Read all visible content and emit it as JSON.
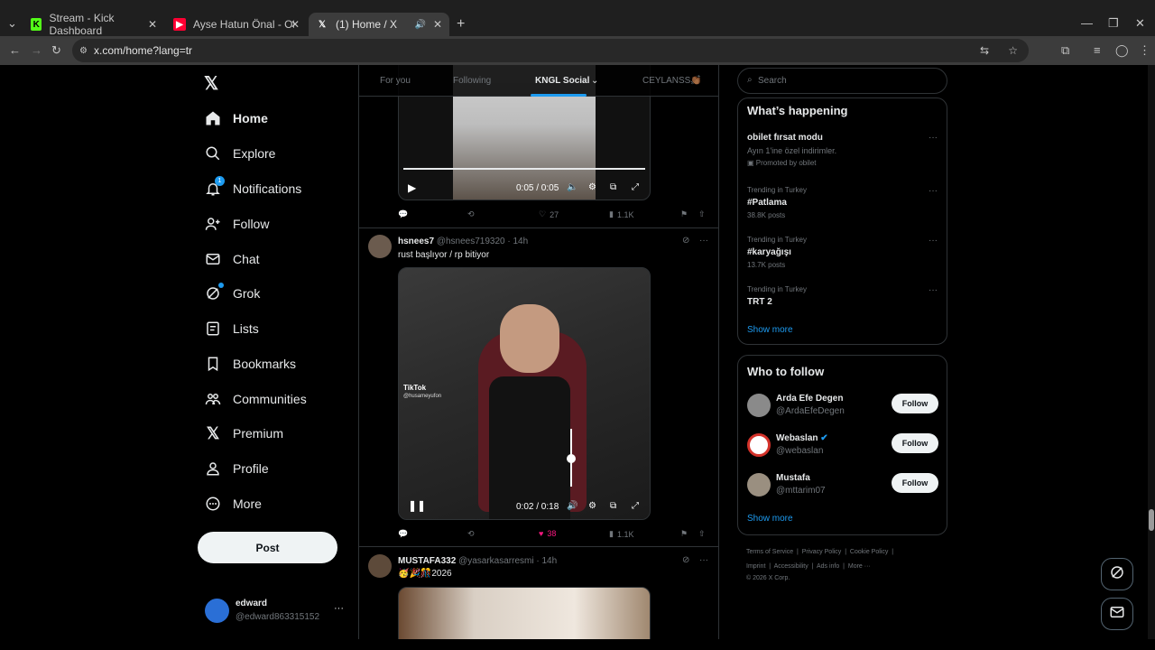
{
  "browser": {
    "tabs": [
      {
        "title": "Stream - Kick Dashboard",
        "favicon": "kick-icon",
        "color": "#53fc18"
      },
      {
        "title": "Ayse Hatun Önal - Olay - YouTu",
        "favicon": "youtube-icon",
        "color": "#ff0033"
      },
      {
        "title": "(1) Home / X",
        "favicon": "x-icon",
        "color": "#ffffff"
      }
    ],
    "url": "x.com/home?lang=tr"
  },
  "nav": {
    "items": [
      {
        "label": "Home",
        "icon": "home-icon"
      },
      {
        "label": "Explore",
        "icon": "search-icon"
      },
      {
        "label": "Notifications",
        "icon": "bell-icon",
        "badge": "1"
      },
      {
        "label": "Follow",
        "icon": "follow-icon"
      },
      {
        "label": "Chat",
        "icon": "mail-icon"
      },
      {
        "label": "Grok",
        "icon": "grok-icon"
      },
      {
        "label": "Lists",
        "icon": "list-icon"
      },
      {
        "label": "Bookmarks",
        "icon": "bookmark-icon"
      },
      {
        "label": "Communities",
        "icon": "communities-icon"
      },
      {
        "label": "Premium",
        "icon": "x-icon"
      },
      {
        "label": "Profile",
        "icon": "person-icon"
      },
      {
        "label": "More",
        "icon": "more-icon"
      }
    ],
    "post_label": "Post",
    "user": {
      "name": "edward",
      "handle": "@edward863315152"
    }
  },
  "feed": {
    "tabs": [
      "For you",
      "Following",
      "KNGL Social",
      "CEYLANSS👏🏾"
    ],
    "post0": {
      "time": "0:05 / 0:05",
      "likes": "27",
      "views": "1.1K"
    },
    "post1": {
      "name": "hsnees7",
      "handle": "@hsnees719320",
      "age": "· 14h",
      "text": "rust başlıyor / rp bitiyor",
      "watermark": "TikTok",
      "watermark_handle": "@husameyufon",
      "time": "0:02 / 0:18",
      "likes": "38",
      "views": "1.1K"
    },
    "post2": {
      "name": "MUSTAFA332",
      "handle": "@yasarkasarresmi",
      "age": "· 14h",
      "text": "🥳🎉🎊2026"
    }
  },
  "right": {
    "search_placeholder": "Search",
    "happening_title": "What’s happening",
    "trends": [
      {
        "context": "",
        "title": "obilet fırsat modu",
        "sub": "Ayın 1'ine özel indirimler.",
        "promo": "Promoted by obilet"
      },
      {
        "context": "Trending in Turkey",
        "title": "#Patlama",
        "sub": "38.8K posts"
      },
      {
        "context": "Trending in Turkey",
        "title": "#karyağışı",
        "sub": "13.7K posts"
      },
      {
        "context": "Trending in Turkey",
        "title": "TRT 2",
        "sub": ""
      }
    ],
    "show_more": "Show more",
    "wtf_title": "Who to follow",
    "who_to_follow": [
      {
        "name": "Arda Efe Degen",
        "handle": "@ArdaEfeDegen",
        "button": "Follow"
      },
      {
        "name": "Webaslan",
        "handle": "@webaslan",
        "button": "Follow",
        "verified": true
      },
      {
        "name": "Mustafa",
        "handle": "@mttarim07",
        "button": "Follow"
      }
    ],
    "show_more2": "Show more",
    "footer": {
      "line1": [
        "Terms of Service",
        "Privacy Policy",
        "Cookie Policy"
      ],
      "line2": [
        "Imprint",
        "Accessibility",
        "Ads info",
        "More ···"
      ],
      "copyright": "© 2026 X Corp."
    }
  },
  "colors": {
    "accent": "#1d9bf0",
    "like": "#f91880"
  }
}
